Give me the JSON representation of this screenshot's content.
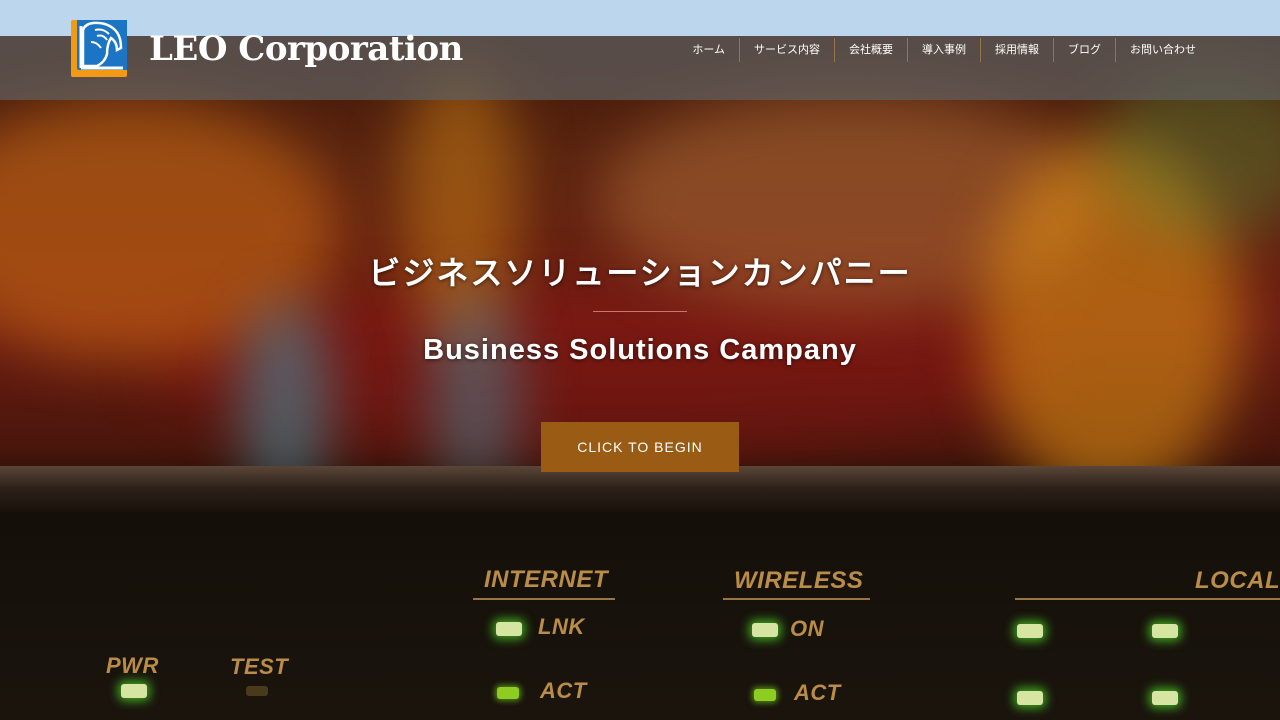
{
  "brand": {
    "name": "LEO Corporation"
  },
  "nav": {
    "items": [
      {
        "label": "ホーム"
      },
      {
        "label": "サービス内容"
      },
      {
        "label": "会社概要"
      },
      {
        "label": "導入事例"
      },
      {
        "label": "採用情報"
      },
      {
        "label": "ブログ"
      },
      {
        "label": "お問い合わせ"
      }
    ]
  },
  "hero": {
    "title": "ビジネスソリューションカンパニー",
    "subtitle": "Business Solutions Campany",
    "cta_label": "CLICK TO BEGIN"
  },
  "device_panel": {
    "labels": {
      "internet": "INTERNET",
      "wireless": "WIRELESS",
      "local": "LOCAL",
      "pwr": "PWR",
      "test": "TEST",
      "lnk": "LNK",
      "on": "ON",
      "act1": "ACT",
      "act2": "ACT"
    }
  },
  "colors": {
    "top_strip": "#bcd6ee",
    "cta_background": "#9a5c14",
    "divider": "#c8786a",
    "logo_orange": "#f29a14",
    "logo_blue": "#1b74c4"
  }
}
